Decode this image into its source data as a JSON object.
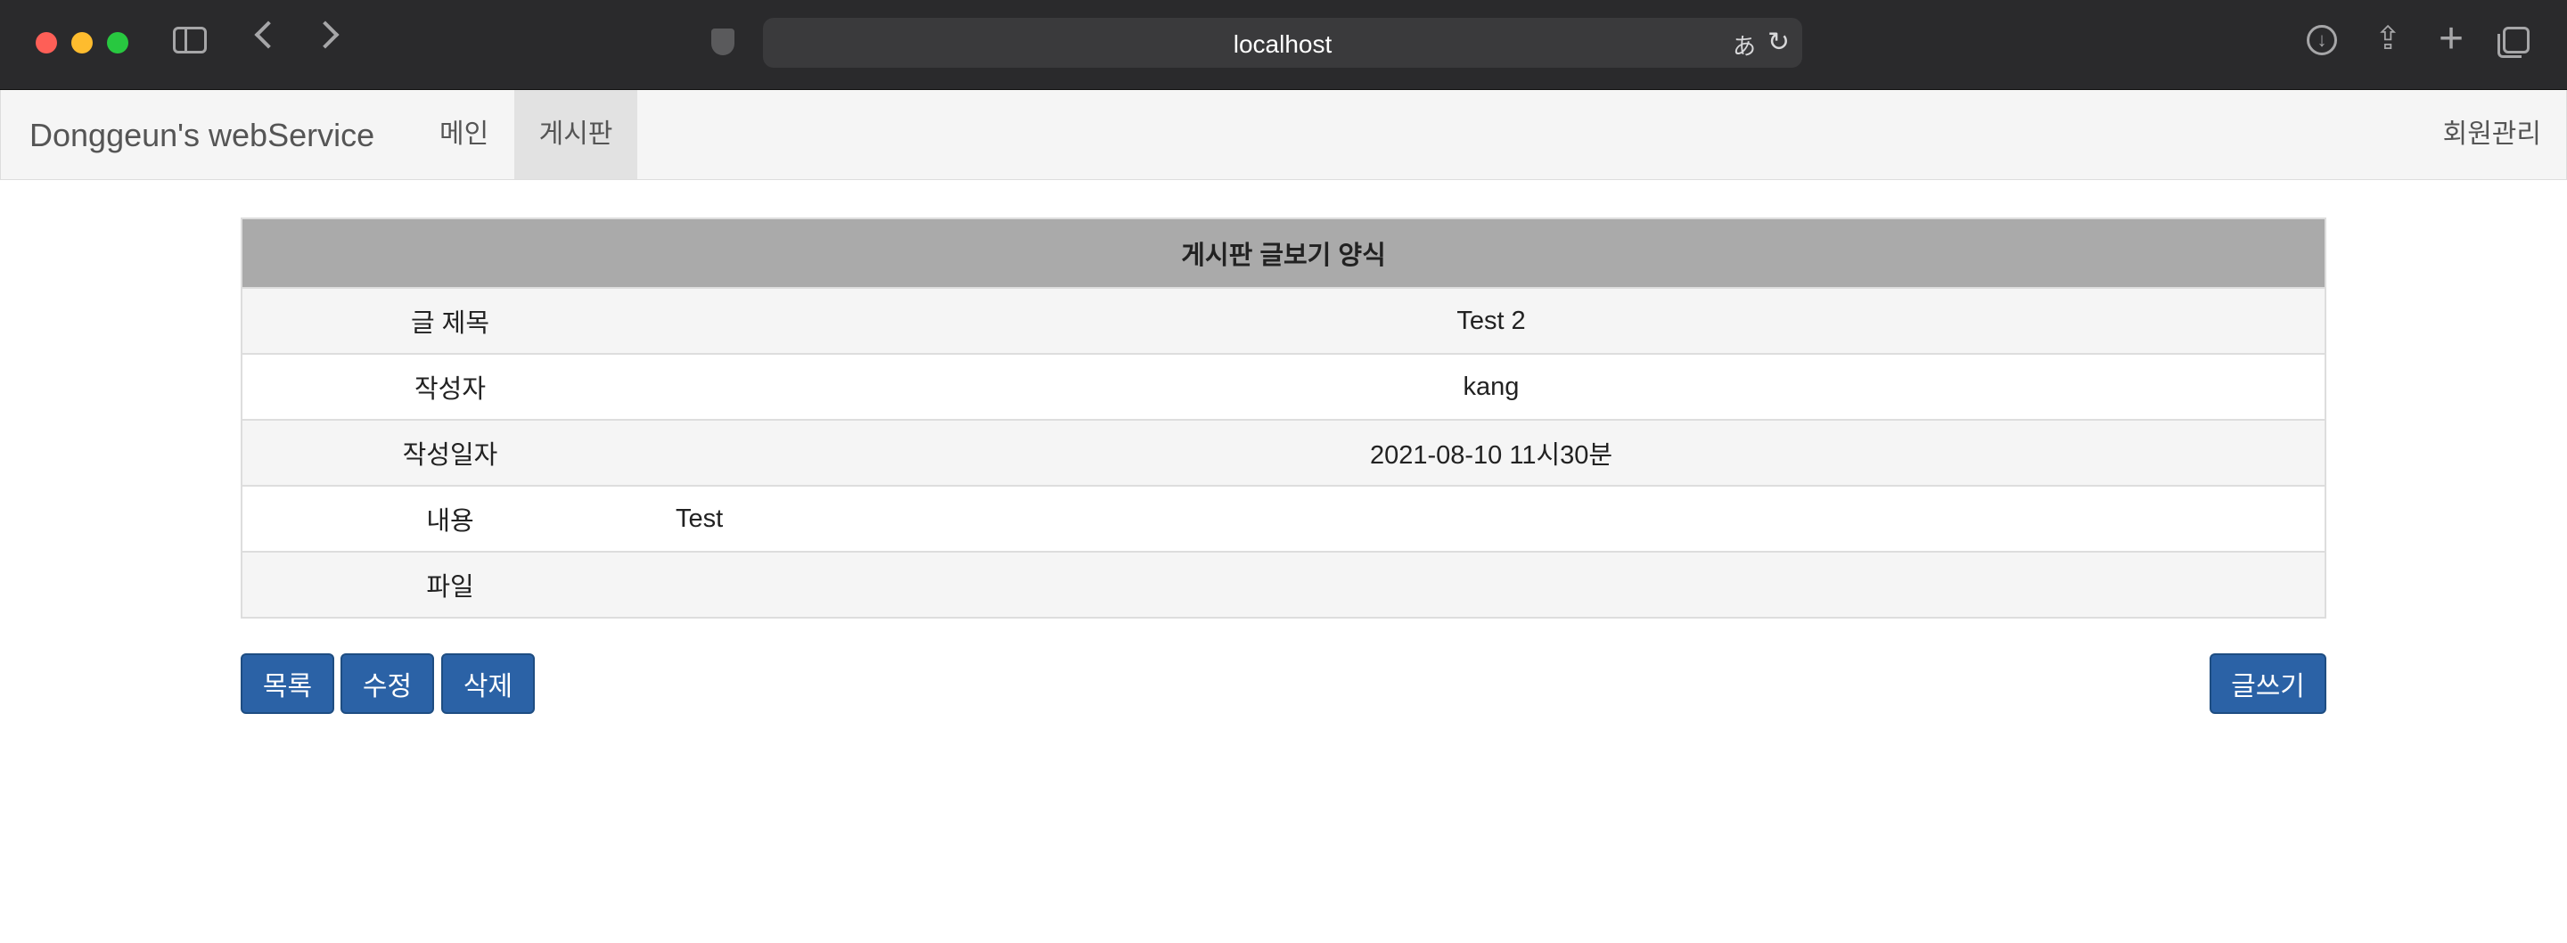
{
  "browser": {
    "url": "localhost",
    "icons": [
      "sidebar-toggle-icon",
      "back-arrow-icon",
      "forward-arrow-icon",
      "shield-icon",
      "translate-icon",
      "reload-icon",
      "download-icon",
      "share-icon",
      "new-tab-icon",
      "tab-overview-icon"
    ]
  },
  "navbar": {
    "brand": "Donggeun's webService",
    "items": [
      {
        "label": "메인",
        "active": false
      },
      {
        "label": "게시판",
        "active": true
      }
    ],
    "right_item": "회원관리"
  },
  "board": {
    "header": "게시판 글보기 양식",
    "rows": [
      {
        "label": "글 제목",
        "value": "Test 2"
      },
      {
        "label": "작성자",
        "value": "kang"
      },
      {
        "label": "작성일자",
        "value": "2021-08-10 11시30분"
      },
      {
        "label": "내용",
        "value": "Test"
      },
      {
        "label": "파일",
        "value": ""
      }
    ]
  },
  "buttons": {
    "list": "목록",
    "edit": "수정",
    "delete": "삭제",
    "write": "글쓰기"
  },
  "colors": {
    "button_primary": "#2b62a6",
    "table_header": "#aaaaaa",
    "navbar_bg": "#f5f5f5"
  }
}
